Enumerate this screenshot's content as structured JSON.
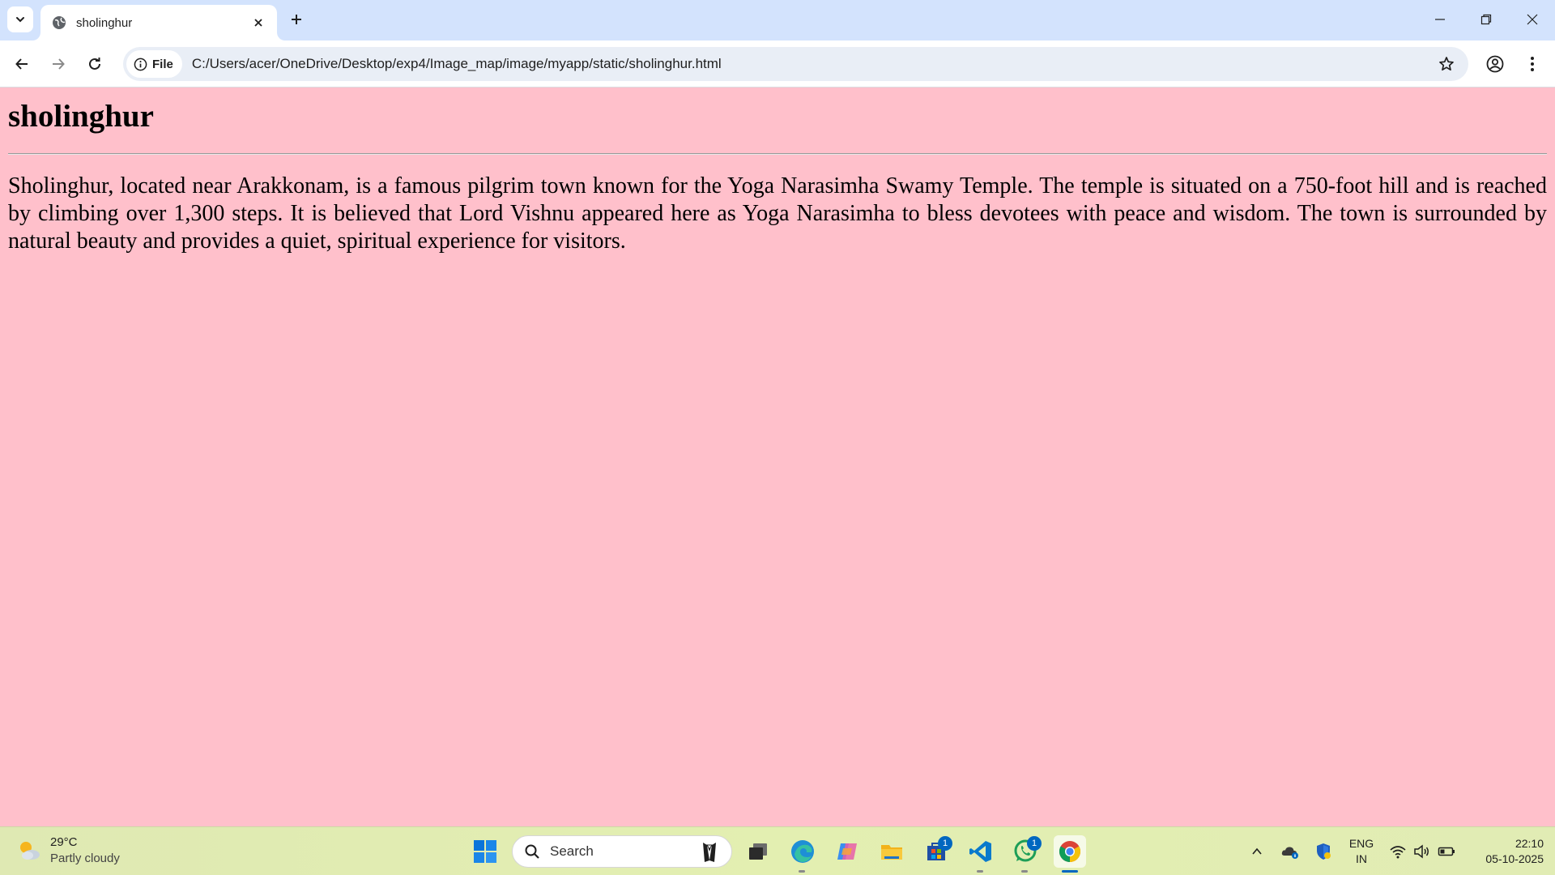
{
  "browser": {
    "tab_title": "sholinghur",
    "chip_label": "File",
    "url": "C:/Users/acer/OneDrive/Desktop/exp4/Image_map/image/myapp/static/sholinghur.html"
  },
  "page": {
    "heading": "sholinghur",
    "paragraph": "Sholinghur, located near Arakkonam, is a famous pilgrim town known for the Yoga Narasimha Swamy Temple. The temple is situated on a 750-foot hill and is reached by climbing over 1,300 steps. It is believed that Lord Vishnu appeared here as Yoga Narasimha to bless devotees with peace and wisdom. The town is surrounded by natural beauty and provides a quiet, spiritual experience for visitors.",
    "background": "#ffc0cb"
  },
  "taskbar": {
    "weather_temp": "29°C",
    "weather_desc": "Partly cloudy",
    "search_label": "Search",
    "store_badge": "1",
    "whatsapp_badge": "1",
    "lang_line1": "ENG",
    "lang_line2": "IN",
    "time": "22:10",
    "date": "05-10-2025"
  }
}
